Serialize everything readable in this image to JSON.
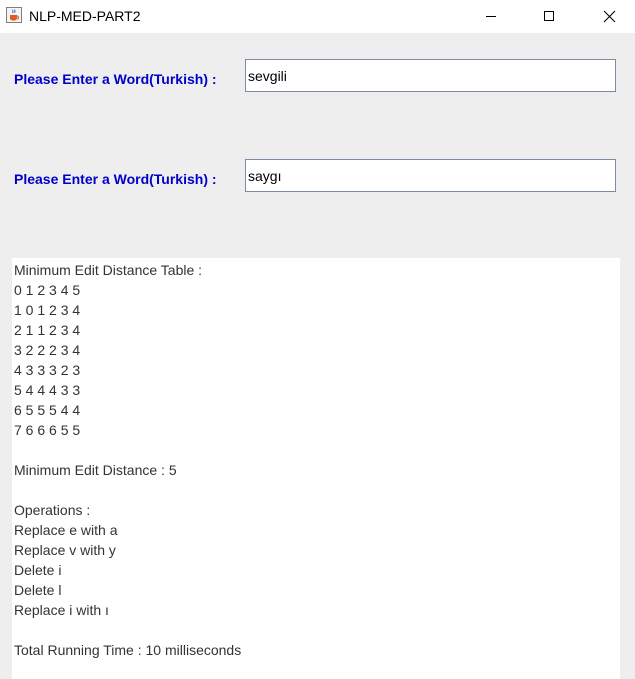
{
  "window": {
    "title": "NLP-MED-PART2",
    "icon": "java-cup-icon"
  },
  "form": {
    "label1": "Please Enter a Word(Turkish) :",
    "word1": "sevgili",
    "label2": "Please Enter a Word(Turkish) :",
    "word2": "saygı"
  },
  "output": {
    "table_title": "Minimum Edit Distance Table :",
    "table_rows": [
      "0 1 2 3 4 5",
      "1 0 1 2 3 4",
      "2 1 1 2 3 4",
      "3 2 2 2 3 4",
      "4 3 3 3 2 3",
      "5 4 4 4 3 3",
      "6 5 5 5 4 4",
      "7 6 6 6 5 5"
    ],
    "distance_text": "Minimum Edit Distance : 5",
    "operations_title": "Operations :",
    "operations": [
      "Replace e with a",
      "Replace v with y",
      "Delete i",
      "Delete l",
      "Replace i with ı"
    ],
    "running_time": "Total Running Time : 10 milliseconds"
  },
  "colors": {
    "label": "#0000cc",
    "background": "#eeeeee"
  }
}
